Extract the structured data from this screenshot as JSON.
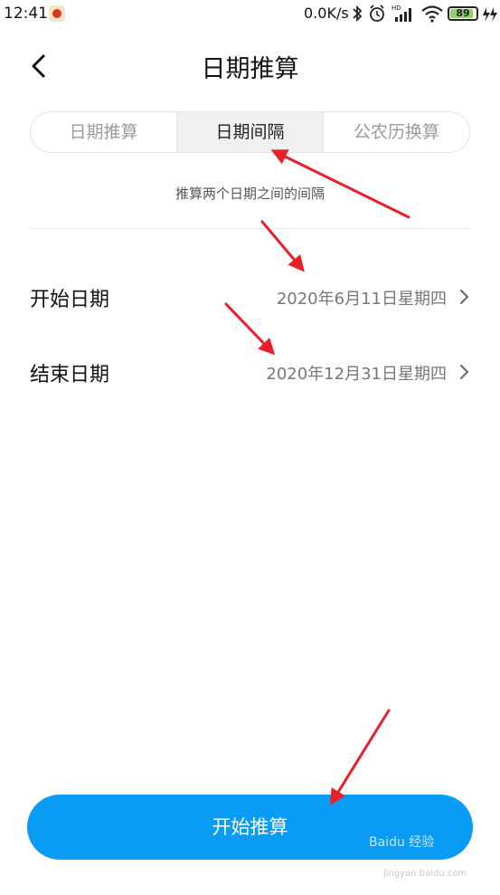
{
  "status_bar": {
    "time": "12:41",
    "network_speed": "0.0K/s",
    "battery_percent": "89",
    "icons": [
      "app-notification-icon",
      "bluetooth-icon",
      "alarm-icon",
      "hd-signal-icon",
      "wifi-icon",
      "battery-icon",
      "charging-icon"
    ]
  },
  "header": {
    "back_icon": "chevron-left-icon",
    "title": "日期推算"
  },
  "tabs": [
    {
      "label": "日期推算",
      "active": false
    },
    {
      "label": "日期间隔",
      "active": true
    },
    {
      "label": "公农历换算",
      "active": false
    }
  ],
  "subtitle": "推算两个日期之间的间隔",
  "rows": [
    {
      "label": "开始日期",
      "value": "2020年6月11日星期四"
    },
    {
      "label": "结束日期",
      "value": "2020年12月31日星期四"
    }
  ],
  "action_button": {
    "label": "开始推算"
  },
  "watermark": {
    "text": "Baidu 经验",
    "sub": "jingyan.baidu.com"
  },
  "colors": {
    "accent": "#0a9cf4",
    "annotation_arrow": "#e8202a",
    "battery_fill": "#8fd16b"
  }
}
